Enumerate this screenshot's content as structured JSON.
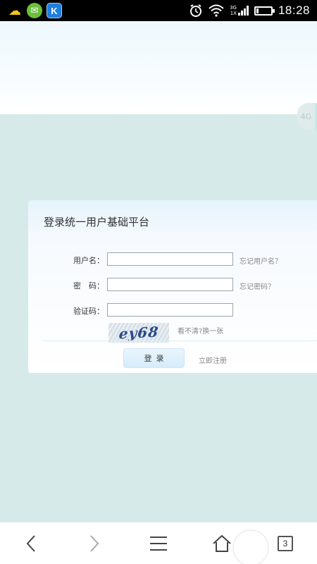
{
  "status_bar": {
    "time": "18:28",
    "network_top": "3G",
    "network_bottom": "1X",
    "k_app_letter": "K",
    "icons": [
      "weather-icon",
      "chat-app-icon",
      "k-app-icon",
      "alarm-icon",
      "wifi-icon",
      "signal-icon",
      "battery-icon"
    ]
  },
  "side_tab": {
    "label": "4G"
  },
  "login": {
    "title": "登录统一用户基础平台",
    "username_label": "用户名：",
    "username_value": "",
    "forgot_username": "忘记用户名？",
    "password_label": "密　码：",
    "password_value": "",
    "forgot_password": "忘记密码？",
    "captcha_label": "验证码：",
    "captcha_value": "",
    "captcha_text": "ey68",
    "captcha_refresh": "看不清?换一张",
    "login_button": "登录",
    "register_link": "立即注册"
  },
  "bottom_nav": {
    "tab_count": "3",
    "icons": [
      "back-icon",
      "forward-icon",
      "menu-icon",
      "home-icon",
      "tabs-icon"
    ]
  },
  "colors": {
    "page_bg": "#d6ebe9",
    "panel_header": "#e6f3fc",
    "status_bar": "#000000"
  }
}
